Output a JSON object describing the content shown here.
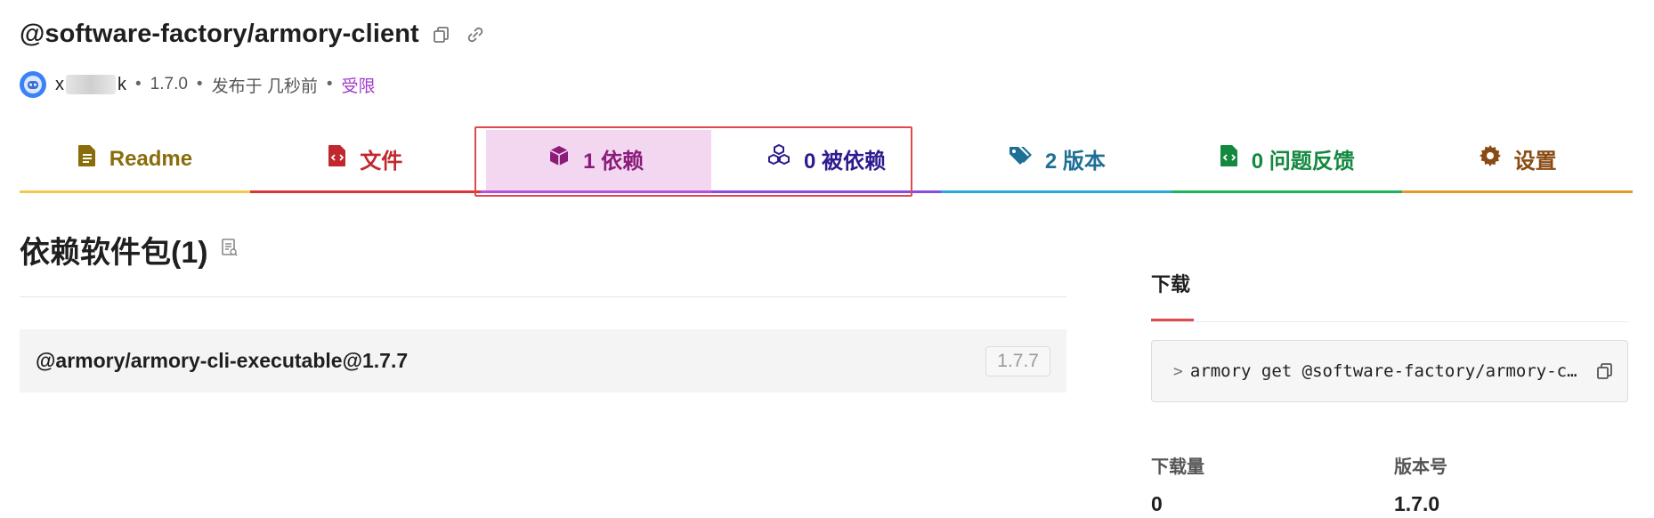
{
  "header": {
    "package_name": "@software-factory/armory-client",
    "author_prefix": "x",
    "author_suffix": "k",
    "version": "1.7.0",
    "published": "发布于 几秒前",
    "access": "受限",
    "separator": "•"
  },
  "tabs": [
    {
      "label": "Readme",
      "icon": "document-icon",
      "color": "#8a6d0b",
      "bar": "#f2c94c"
    },
    {
      "label": "文件",
      "icon": "code-file-icon",
      "color": "#c0282e",
      "bar": "#d93636"
    },
    {
      "label": "1 依赖",
      "icon": "cube-icon",
      "color": "#8b1c7a",
      "bar": "#b44fd6",
      "active": true
    },
    {
      "label": "0 被依赖",
      "icon": "cubes-icon",
      "color": "#2f1a8f",
      "bar": "#8a4be0"
    },
    {
      "label": "2 版本",
      "icon": "tags-icon",
      "color": "#1e6f96",
      "bar": "#2aa6d8"
    },
    {
      "label": "0 问题反馈",
      "icon": "code-file-icon",
      "color": "#13893f",
      "bar": "#1fb25a"
    },
    {
      "label": "设置",
      "icon": "gear-icon",
      "color": "#8a4b12",
      "bar": "#e19a2d"
    }
  ],
  "main": {
    "title": "依赖软件包(1)",
    "dependencies": [
      {
        "name": "@armory/armory-cli-executable@1.7.7",
        "version": "1.7.7"
      }
    ]
  },
  "sidebar": {
    "tab_label": "下载",
    "command_prompt": ">",
    "command": "armory get @software-factory/armory-client",
    "stats": [
      {
        "label": "下载量",
        "value": "0"
      },
      {
        "label": "版本号",
        "value": "1.7.0"
      }
    ]
  },
  "colors": {
    "accent_red": "#e0484f",
    "restricted_purple": "#a23acb",
    "active_tab_bg": "#f3d6f0"
  }
}
